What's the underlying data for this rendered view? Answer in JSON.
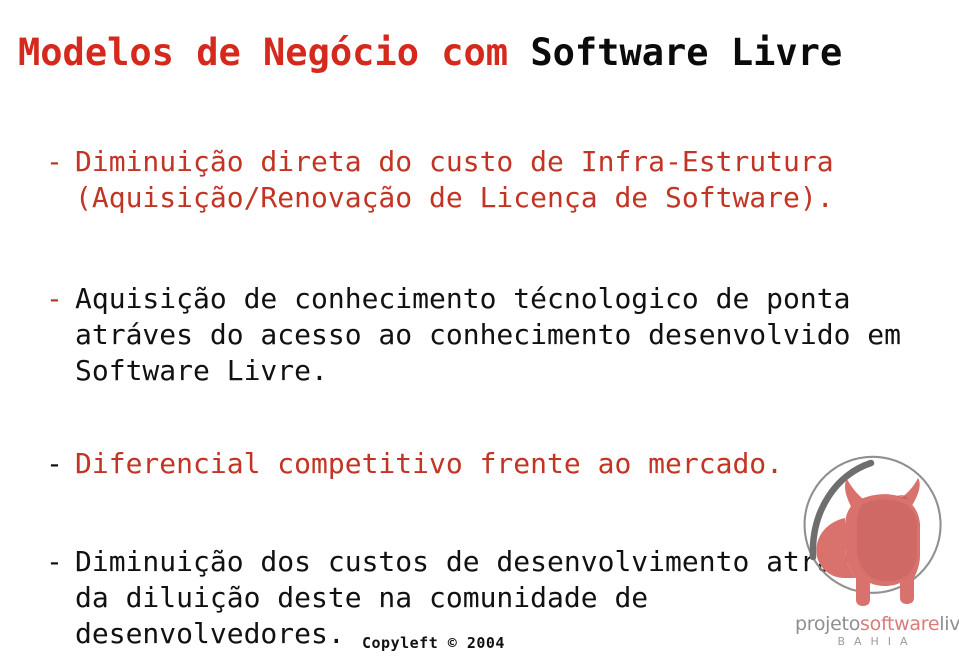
{
  "slide": {
    "title": {
      "red_part": "Modelos de Negócio com ",
      "black_part": "Software Livre"
    },
    "bullets": [
      {
        "marker": "-",
        "marker_color": "red",
        "text_color": "red",
        "text": "Diminuição direta do custo de Infra-Estrutura\n(Aquisição/Renovação de Licença de Software)."
      },
      {
        "marker": "-",
        "marker_color": "red",
        "text_color": "black",
        "text": "Aquisição de conhecimento técnologico de ponta\natráves do acesso ao conhecimento desenvolvido em\nSoftware Livre."
      },
      {
        "marker": "-",
        "marker_color": "black",
        "text_color": "red",
        "text": "Diferencial competitivo frente ao mercado."
      },
      {
        "marker": "-",
        "marker_color": "black",
        "text_color": "black",
        "text": "Diminuição dos custos de desenvolvimento atráves\nda diluição deste na comunidade de\ndesenvolvedores."
      }
    ],
    "footer": {
      "copyleft": "Copyleft © 2004"
    },
    "logo": {
      "mark": "bull-in-circle-logo",
      "wordmark_part1": "projeto",
      "wordmark_part2": "software",
      "wordmark_part3": "livre",
      "subtitle": "BAHIA"
    },
    "colors": {
      "title_red": "#d4291c",
      "body_red": "#c23423",
      "body_black": "#111111",
      "bull_fill": "#d9726d",
      "bull_shade": "#c4605c",
      "circle_gray": "#7a7a7a",
      "wordmark_gray": "#8f8f8f",
      "wordmark_red": "#d97c79",
      "background": "#ffffff"
    }
  }
}
